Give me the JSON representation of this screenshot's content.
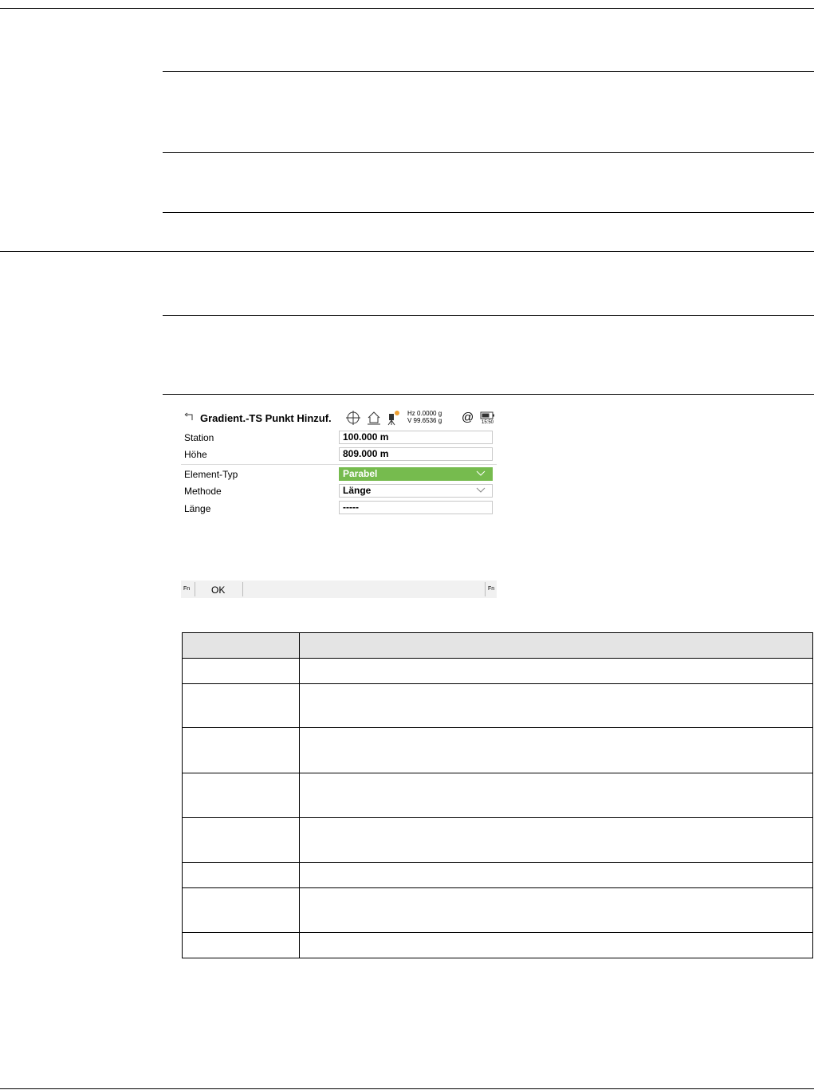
{
  "screen": {
    "title": "Gradient.-TS Punkt Hinzuf.",
    "hz_reading": "Hz 0.0000 g",
    "v_reading": "V  99.6536 g",
    "at_symbol": "@",
    "clock": "15:50",
    "fields": [
      {
        "label": "Station",
        "value": "100.000 m"
      },
      {
        "label": "Höhe",
        "value": "809.000 m"
      },
      {
        "label": "Element-Typ",
        "value": "Parabel"
      },
      {
        "label": "Methode",
        "value": "Länge"
      },
      {
        "label": "Länge",
        "value": "-----"
      }
    ],
    "softkeys": {
      "fn_left": "Fn",
      "ok": "OK",
      "fn_right": "Fn"
    },
    "accent_color": "#76bb4e"
  },
  "icons": [
    "back-icon",
    "crosshair-icon",
    "home-icon",
    "instrument-icon",
    "battery-icon",
    "chevron-down-icon"
  ]
}
